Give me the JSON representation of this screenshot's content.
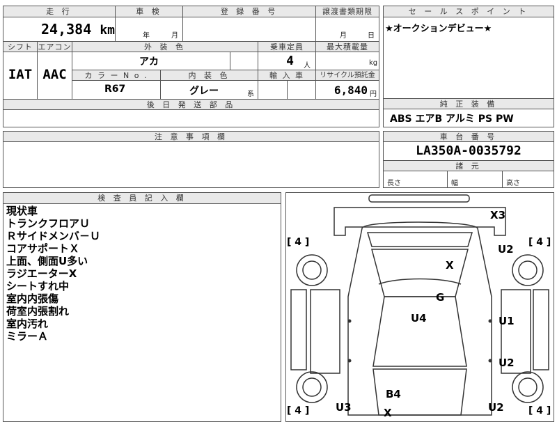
{
  "headers": {
    "mileage": "走 行",
    "inspection": "車 検",
    "registration": "登 録 番 号",
    "transfer_docs": "譲渡書類期限",
    "sales_point": "セ ー ル ス ポ イ ン ト",
    "shift": "シフト",
    "aircon": "エアコン",
    "exterior_color": "外 装 色",
    "capacity": "乗車定員",
    "max_load": "最大積載量",
    "color_no": "カ ラ ー N o .",
    "interior_color": "内 装 色",
    "import": "輸 入 車",
    "recycle": "リサイクル預託金",
    "later_parts": "後 日 発 送 部 品",
    "factory_equipment": "純 正 装 備",
    "notes": "注 意 事 項 欄",
    "chassis": "車 台 番 号",
    "specs": "諸 元",
    "inspector": "検 査 員 記 入 欄"
  },
  "values": {
    "mileage": "24,384",
    "mileage_unit": "km",
    "inspection_year": "年",
    "inspection_month": "月",
    "transfer_month": "月",
    "transfer_day": "日",
    "sales_point": "★オークションデビュー★",
    "shift": "IAT",
    "aircon": "AAC",
    "exterior_color": "アカ",
    "capacity": "4",
    "capacity_unit": "人",
    "max_load_unit": "kg",
    "color_no": "R67",
    "interior_color": "グレー",
    "interior_suffix": "系",
    "recycle_fee": "6,840",
    "recycle_unit": "円",
    "equipment": "ABS エアB アルミ PS PW",
    "chassis_no": "LA350A-0035792",
    "length_label": "長さ",
    "width_label": "幅",
    "height_label": "高さ"
  },
  "inspector_notes": [
    "現状車",
    "トランクフロアＵ",
    "Ｒサイドメンバ－Ｕ",
    "コアサポートＸ",
    "上面、側面U多い",
    "ラジエーターX",
    "シートすれ中",
    "室内内張傷",
    "荷室内張割れ",
    "室内汚れ",
    "ミラーＡ"
  ],
  "diagram": {
    "tire_marks": [
      "[ 4 ]",
      "[ 4 ]",
      "[ 4 ]",
      "[ 4 ]"
    ],
    "damage": [
      "X3",
      "U2",
      "X",
      "G",
      "U4",
      "U1",
      "U2",
      "B4",
      "U3",
      "U2",
      "X"
    ]
  }
}
